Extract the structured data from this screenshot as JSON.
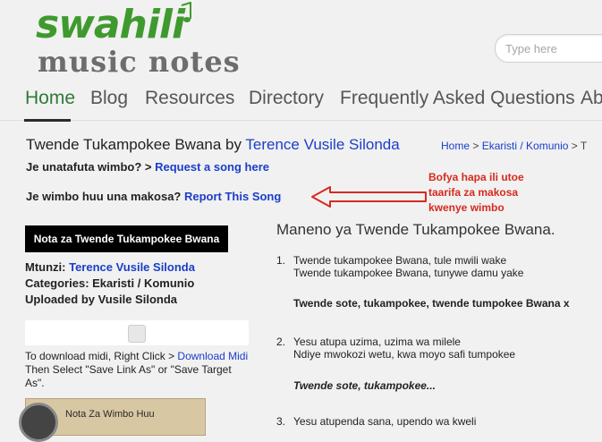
{
  "logo": {
    "top": "swahili",
    "bottom": "music notes"
  },
  "search": {
    "placeholder": "Type here"
  },
  "nav": [
    {
      "label": "Home",
      "active": true
    },
    {
      "label": "Blog"
    },
    {
      "label": "Resources"
    },
    {
      "label": "Directory"
    },
    {
      "label": "Frequently Asked Questions"
    },
    {
      "label": "Ab"
    }
  ],
  "page": {
    "title_prefix": "Twende Tukampokee Bwana by ",
    "composer": "Terence Vusile Silonda"
  },
  "breadcrumb": {
    "home": "Home",
    "sep1": " > ",
    "category": "Ekaristi / Komunio",
    "sep2": " > ",
    "tail": "T"
  },
  "request": {
    "text": "Je unatafuta wimbo? > ",
    "link": "Request a song here"
  },
  "report": {
    "text": "Je wimbo huu una makosa? ",
    "link": "Report This Song"
  },
  "annotation": {
    "line1": "Bofya hapa ili utoe",
    "line2": "taarifa za makosa",
    "line3": "kwenye wimbo"
  },
  "nota_button": "Nota za Twende Tukampokee Bwana",
  "meta": {
    "mtunzi_label": "Mtunzi: ",
    "mtunzi": "Terence Vusile Silonda",
    "categories": "Categories: Ekaristi / Komunio",
    "uploaded": "Uploaded by Vusile Silonda"
  },
  "download": {
    "prefix": "To download midi, Right Click > ",
    "link": "Download Midi",
    "suffix": " Then Select \"Save Link As\" or \"Save Target As\"."
  },
  "thumb_label": "Nota Za Wimbo Huu",
  "lyrics": {
    "title": "Maneno ya Twende Tukampokee Bwana.",
    "v1_num": "1.",
    "v1_l1": "Twende tukampokee Bwana, tule mwili wake",
    "v1_l2": "Twende tukampokee Bwana, tunywe damu yake",
    "chorus1": "Twende sote, tukampokee, twende tumpokee Bwana x",
    "v2_num": "2.",
    "v2_l1": "Yesu atupa uzima, uzima wa milele",
    "v2_l2": "Ndiye mwokozi wetu, kwa moyo safi tumpokee",
    "chorus2": "Twende sote, tukampokee...",
    "v3_num": "3.",
    "v3_l1": "Yesu atupenda sana, upendo wa kweli"
  },
  "colors": {
    "link": "#1a3ec9",
    "accent": "#3f9a2e",
    "annotation": "#d62a1e"
  }
}
